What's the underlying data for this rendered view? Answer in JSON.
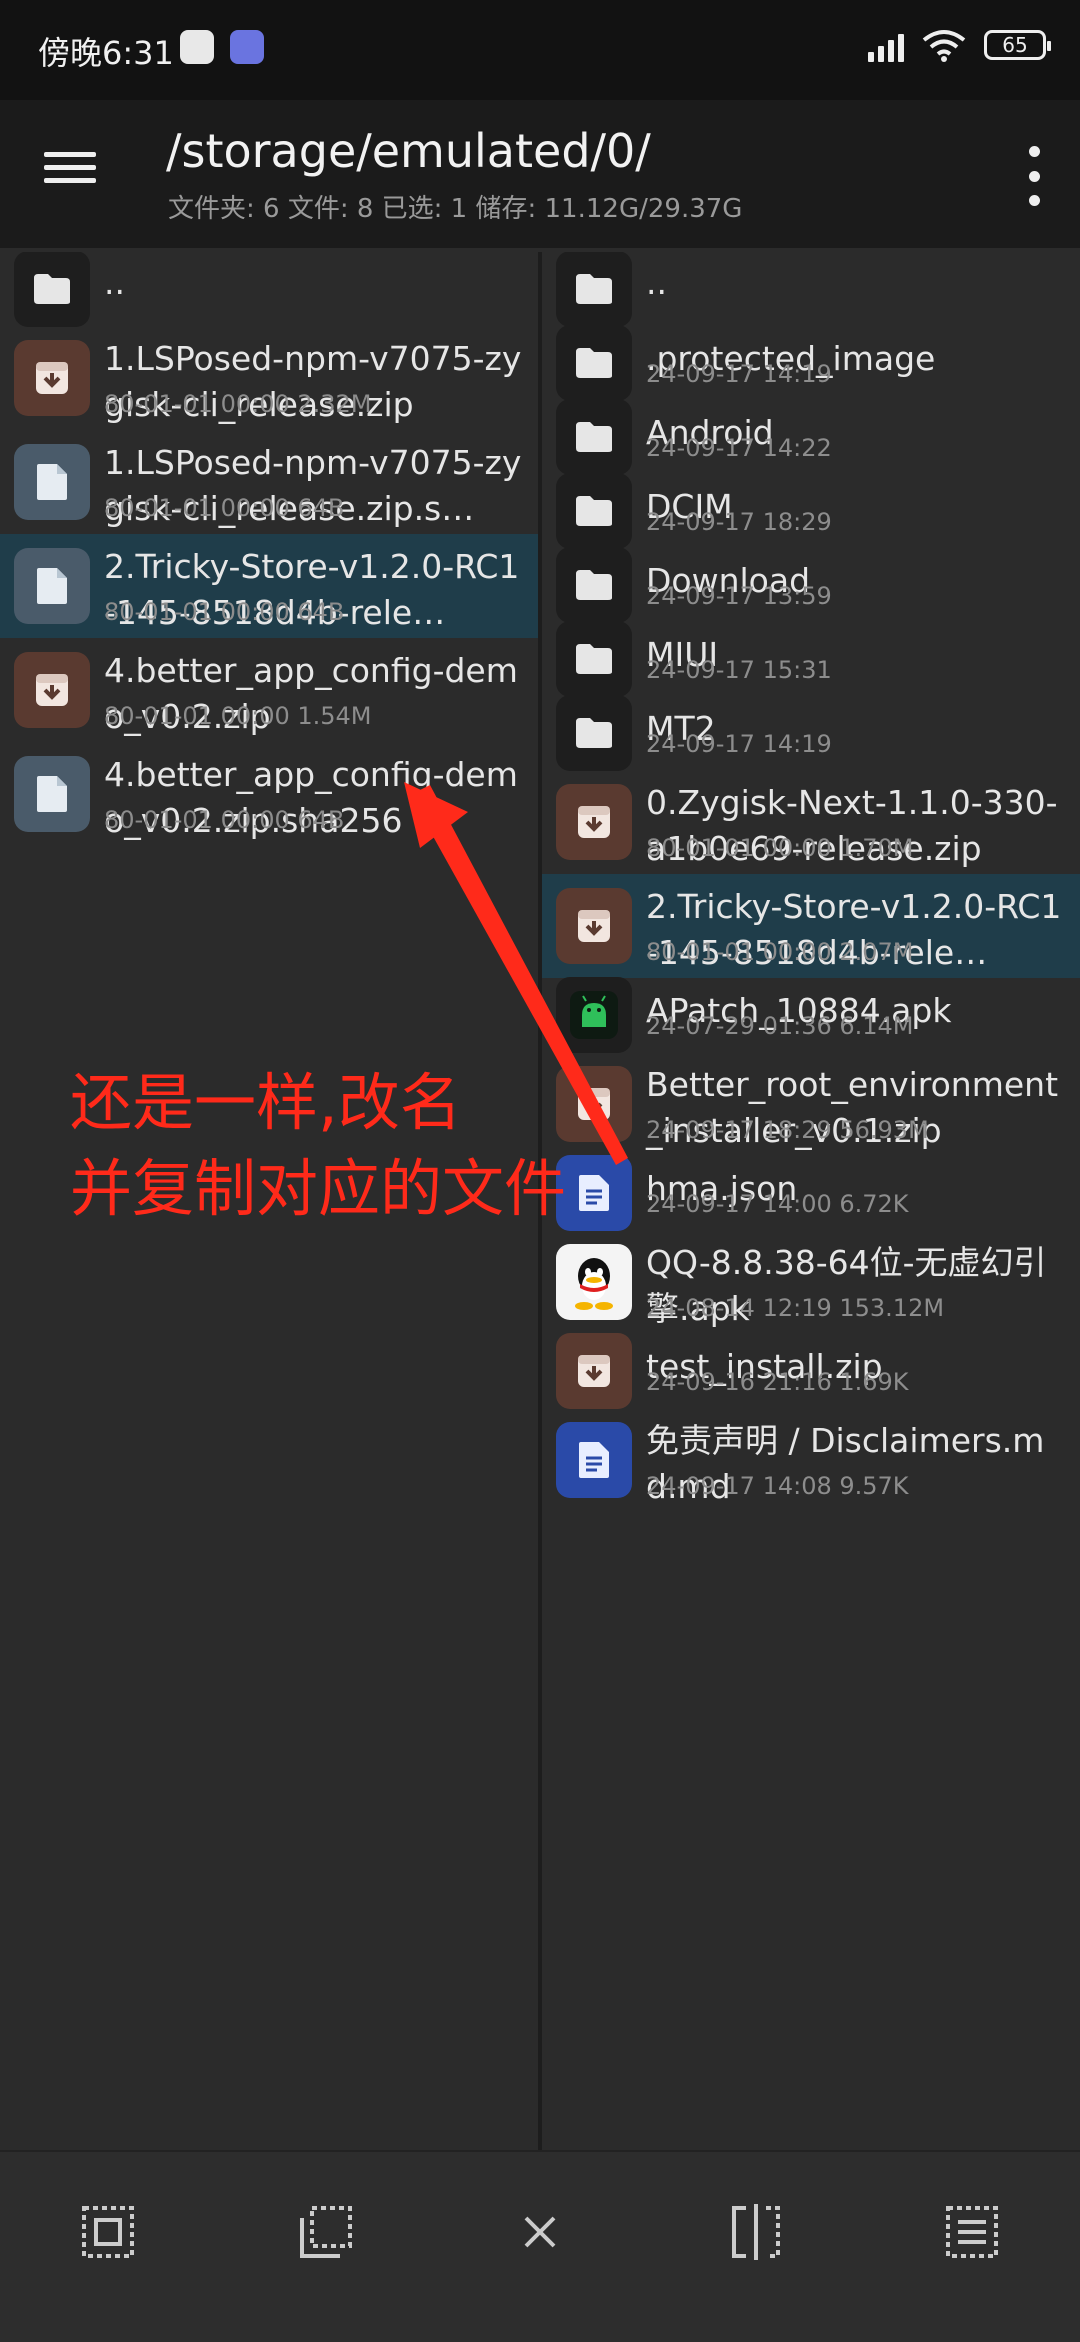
{
  "status_bar": {
    "time": "傍晚6:31",
    "battery": "65"
  },
  "toolbar": {
    "path": "/storage/emulated/0/",
    "summary": "文件夹: 6  文件: 8  已选: 1  储存: 11.12G/29.37G"
  },
  "left_pane": {
    "items": [
      {
        "name": "..",
        "meta": "",
        "type": "folder",
        "selected": false
      },
      {
        "name": "1.LSPosed-npm-v7075-zygisk-cli_release.zip",
        "meta": "80-01-01 00:00  2.32M",
        "type": "archive",
        "selected": false
      },
      {
        "name": "1.LSPosed-npm-v7075-zygisk-cli_release.zip.s…",
        "meta": "80-01-01 00:00  64B",
        "type": "doc",
        "selected": false
      },
      {
        "name": "2.Tricky-Store-v1.2.0-RC1-145-8518d4b-rele…",
        "meta": "80-01-01 00:00  64B",
        "type": "doc",
        "selected": true
      },
      {
        "name": "4.better_app_config-demo_v0.2.zip",
        "meta": "80-01-01 00:00  1.54M",
        "type": "archive",
        "selected": false
      },
      {
        "name": "4.better_app_config-demo_v0.2.zip.sha256",
        "meta": "80-01-01 00:00  64B",
        "type": "doc",
        "selected": false
      }
    ]
  },
  "right_pane": {
    "items": [
      {
        "name": "..",
        "meta": "",
        "type": "folder",
        "selected": false
      },
      {
        "name": ".protected_image",
        "meta": "24-09-17 14:19",
        "type": "folder",
        "selected": false
      },
      {
        "name": "Android",
        "meta": "24-09-17 14:22",
        "type": "folder",
        "selected": false
      },
      {
        "name": "DCIM",
        "meta": "24-09-17 18:29",
        "type": "folder",
        "selected": false
      },
      {
        "name": "Download",
        "meta": "24-09-17 13:59",
        "type": "folder",
        "selected": false
      },
      {
        "name": "MIUI",
        "meta": "24-09-17 15:31",
        "type": "folder",
        "selected": false
      },
      {
        "name": "MT2",
        "meta": "24-09-17 14:19",
        "type": "folder",
        "selected": false
      },
      {
        "name": "0.Zygisk-Next-1.1.0-330-a1b0e69-release.zip",
        "meta": "80-01-01 00:00  1.70M",
        "type": "archive",
        "selected": false
      },
      {
        "name": "2.Tricky-Store-v1.2.0-RC1-145-8518d4b-rele…",
        "meta": "80-01-01 00:00  2.07M",
        "type": "archive",
        "selected": true
      },
      {
        "name": "APatch_10884.apk",
        "meta": "24-07-29 01:36  6.14M",
        "type": "apk",
        "selected": false
      },
      {
        "name": "Better_root_environment_installer_v0.1.zip",
        "meta": "24-09-17 18:29  56.93M",
        "type": "archive",
        "selected": false
      },
      {
        "name": "hma.json",
        "meta": "24-09-17 14:00  6.72K",
        "type": "json",
        "selected": false
      },
      {
        "name": "QQ-8.8.38-64位-无虚幻引擎.apk",
        "meta": "24-08-14 12:19  153.12M",
        "type": "qq",
        "selected": false
      },
      {
        "name": "test_install.zip",
        "meta": "24-09-16 21:16  1.69K",
        "type": "archive",
        "selected": false
      },
      {
        "name": "免责声明 / Disclaimers.md.md",
        "meta": "24-09-17 14:08  9.57K",
        "type": "json",
        "selected": false
      }
    ]
  },
  "annotation": {
    "line1": "还是一样,改名",
    "line2": "并复制对应的文件"
  },
  "bottom_bar": {
    "buttons": [
      "select-all-icon",
      "select-range-icon",
      "close-icon",
      "split-compare-icon",
      "select-list-icon"
    ]
  }
}
